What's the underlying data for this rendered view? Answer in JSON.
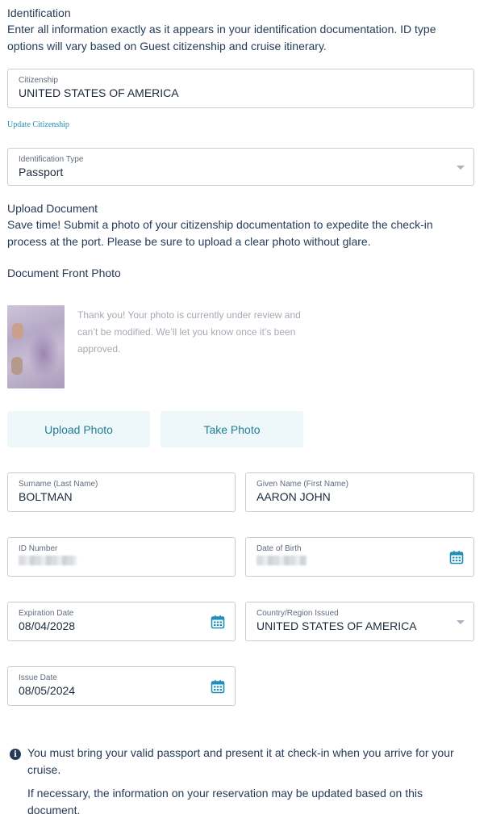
{
  "identification": {
    "title": "Identification",
    "description": "Enter all information exactly as it appears in your identification documentation. ID type options will vary based on Guest citizenship and cruise itinerary."
  },
  "citizenship": {
    "label": "Citizenship",
    "value": "UNITED STATES OF AMERICA",
    "update_link": "Update Citizenship"
  },
  "id_type": {
    "label": "Identification Type",
    "value": "Passport"
  },
  "upload": {
    "title": "Upload Document",
    "description": "Save time! Submit a photo of your citizenship documentation to expedite the check-in process at the port. Please be sure to upload a clear photo without glare.",
    "front_label": "Document Front Photo",
    "review_message": "Thank you! Your photo is currently under review and can’t be modified. We’ll let you know once it’s been approved.",
    "upload_button": "Upload Photo",
    "take_button": "Take Photo"
  },
  "form": {
    "surname": {
      "label": "Surname (Last Name)",
      "value": "BOLTMAN"
    },
    "given_name": {
      "label": "Given Name (First Name)",
      "value": "AARON JOHN"
    },
    "id_number": {
      "label": "ID Number"
    },
    "dob": {
      "label": "Date of Birth"
    },
    "expiration": {
      "label": "Expiration Date",
      "value": "08/04/2028"
    },
    "country": {
      "label": "Country/Region Issued",
      "value": "UNITED STATES OF AMERICA"
    },
    "issue": {
      "label": "Issue Date",
      "value": "08/05/2024"
    }
  },
  "notice": {
    "line1": "You must bring your valid passport and present it at check-in when you arrive for your cruise.",
    "line2": "If necessary, the information on your reservation may be updated based on this document."
  },
  "colors": {
    "accent": "#1f7f96",
    "button_bg": "#eef7f9",
    "text": "#253b56"
  },
  "icons": {
    "calendar": "calendar-icon",
    "info": "info-icon",
    "dropdown": "chevron-down-icon"
  }
}
